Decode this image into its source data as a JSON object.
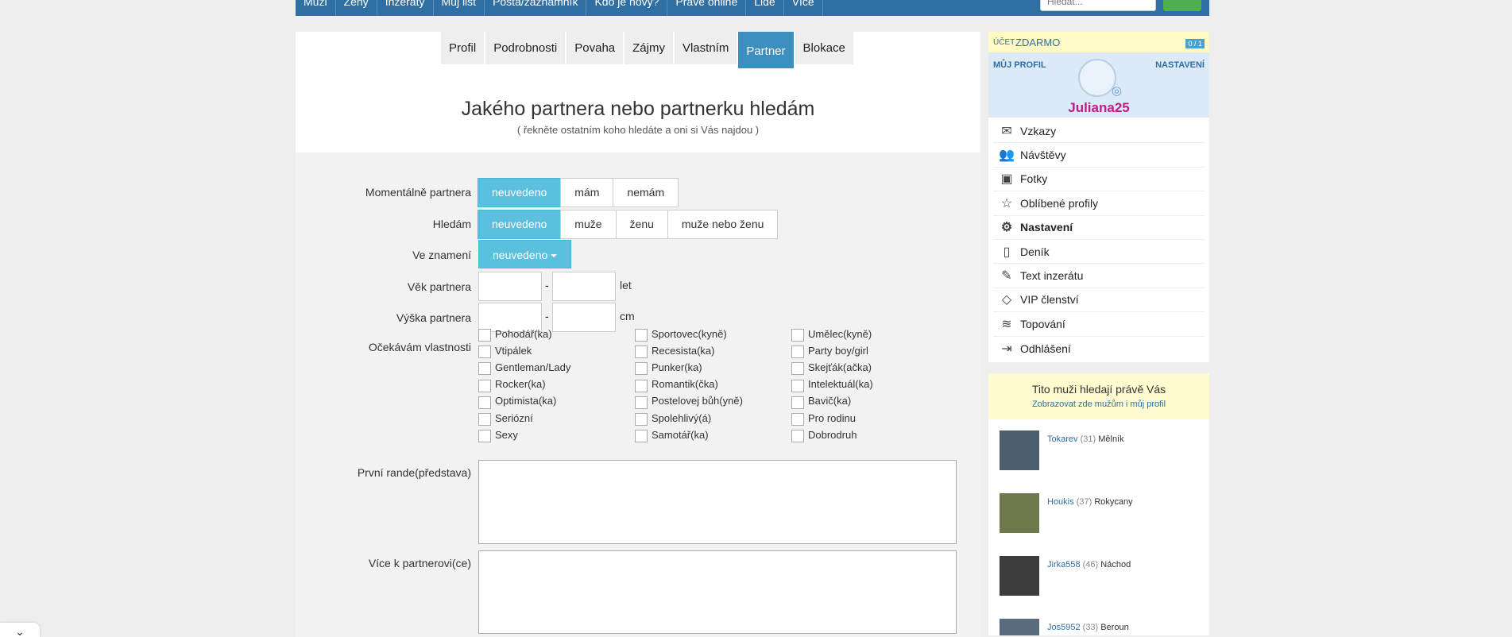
{
  "topnav": {
    "items": [
      "Muži",
      "Ženy",
      "Inzeráty",
      "Můj list",
      "Pošta/zaznamník",
      "Kdo je novy?",
      "Právě online",
      "Lidé",
      "Více"
    ],
    "search_placeholder": "Hledat..."
  },
  "tabs": [
    "Profil",
    "Podrobnosti",
    "Povaha",
    "Zájmy",
    "Vlastním",
    "Partner",
    "Blokace"
  ],
  "active_tab": "Partner",
  "page": {
    "title": "Jakého partnera nebo partnerku hledám",
    "subtitle": "( řekněte ostatním koho hledáte a oni si Vás najdou )"
  },
  "form": {
    "momentalne": {
      "label": "Momentálně partnera",
      "options": [
        "neuvedeno",
        "mám",
        "nemám"
      ],
      "selected": "neuvedeno"
    },
    "hledam": {
      "label": "Hledám",
      "options": [
        "neuvedeno",
        "muže",
        "ženu",
        "muže nebo ženu"
      ],
      "selected": "neuvedeno"
    },
    "znameni": {
      "label": "Ve znamení",
      "value": "neuvedeno"
    },
    "vek": {
      "label": "Věk partnera",
      "from": "",
      "to": "",
      "dash": "-",
      "unit": "let"
    },
    "vyska": {
      "label": "Výška partnera",
      "from": "",
      "to": "",
      "dash": "-",
      "unit": "cm"
    },
    "vlastnosti": {
      "label": "Očekávám vlastnosti",
      "col1": [
        "Pohodář(ka)",
        "Vtipálek",
        "Gentleman/Lady",
        "Rocker(ka)",
        "Optimista(ka)",
        "Seriózní",
        "Sexy"
      ],
      "col2": [
        "Sportovec(kyně)",
        "Recesista(ka)",
        "Punker(ka)",
        "Romantik(čka)",
        "Postelovej bůh(yně)",
        "Spolehlivý(á)",
        "Samotář(ka)"
      ],
      "col3": [
        "Umělec(kyně)",
        "Party boy/girl",
        "Skejťák(ačka)",
        "Intelektuál(ka)",
        "Bavič(ka)",
        "Pro rodinu",
        "Dobrodruh"
      ]
    },
    "prvni_rande": {
      "label": "První rande(představa)",
      "value": ""
    },
    "vice": {
      "label": "Více k partnerovi(ce)",
      "value": ""
    }
  },
  "account": {
    "ucet": "ÚČET",
    "plan": "ZDARMO",
    "badge": "0 / 1",
    "my_profile": "MŮJ PROFIL",
    "settings": "NASTAVENÍ",
    "username": "Juliana25"
  },
  "menu": [
    {
      "label": "Vzkazy",
      "icon": "envelope-icon",
      "glyph": "✉"
    },
    {
      "label": "Návštěvy",
      "icon": "users-icon",
      "glyph": "👥"
    },
    {
      "label": "Fotky",
      "icon": "photos-icon",
      "glyph": "▣"
    },
    {
      "label": "Oblíbené profily",
      "icon": "star-icon",
      "glyph": "☆"
    },
    {
      "label": "Nastavení",
      "icon": "gear-icon",
      "glyph": "⚙"
    },
    {
      "label": "Deník",
      "icon": "diary-icon",
      "glyph": "▯"
    },
    {
      "label": "Text inzerátu",
      "icon": "edit-icon",
      "glyph": "✎"
    },
    {
      "label": "VIP členství",
      "icon": "diamond-icon",
      "glyph": "◇"
    },
    {
      "label": "Topování",
      "icon": "top-icon",
      "glyph": "≋"
    },
    {
      "label": "Odhlášení",
      "icon": "logout-icon",
      "glyph": "⇥"
    }
  ],
  "active_menu": "Nastavení",
  "looking": {
    "title": "Tito muži hledají právě Vás",
    "link": "Zobrazovat zde mužům i můj profil",
    "people": [
      {
        "name": "Tokarev",
        "age": "(31)",
        "city": "Mělník",
        "color": "#4a5e6e"
      },
      {
        "name": "Houkis",
        "age": "(37)",
        "city": "Rokycany",
        "color": "#6e7a4e"
      },
      {
        "name": "Jirka558",
        "age": "(46)",
        "city": "Náchod",
        "color": "#3c3c3c"
      },
      {
        "name": "Jos5952",
        "age": "(33)",
        "city": "Beroun",
        "color": "#5a6b80"
      }
    ]
  },
  "colors": {
    "accent": "#5bc0de",
    "tab_active": "#3d8fbf",
    "nav": "#2f6fa3",
    "username": "#c21a8a"
  }
}
